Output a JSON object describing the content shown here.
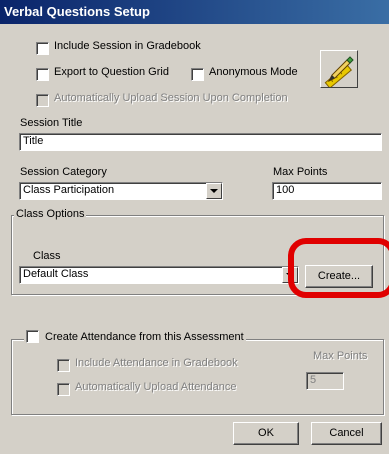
{
  "window": {
    "title": "Verbal Questions Setup"
  },
  "options": {
    "include_gradebook": "Include Session in Gradebook",
    "export_grid": "Export to Question Grid",
    "anonymous": "Anonymous Mode",
    "auto_upload": "Automatically Upload Session Upon Completion",
    "icon": "ruler-pencil-icon"
  },
  "session": {
    "title_label": "Session Title",
    "title_value": "Title",
    "category_label": "Session Category",
    "category_value": "Class Participation",
    "max_points_label": "Max Points",
    "max_points_value": "100"
  },
  "class_options": {
    "group_label": "Class Options",
    "class_label": "Class",
    "class_value": "Default Class",
    "create_button": "Create...",
    "highlight_color": "#e00000"
  },
  "attendance": {
    "create_label": "Create Attendance from this Assessment",
    "include_label": "Include Attendance in Gradebook",
    "auto_upload_label": "Automatically Upload Attendance",
    "max_points_label": "Max Points",
    "max_points_value": "5"
  },
  "footer": {
    "ok_label": "OK",
    "cancel_label": "Cancel"
  }
}
